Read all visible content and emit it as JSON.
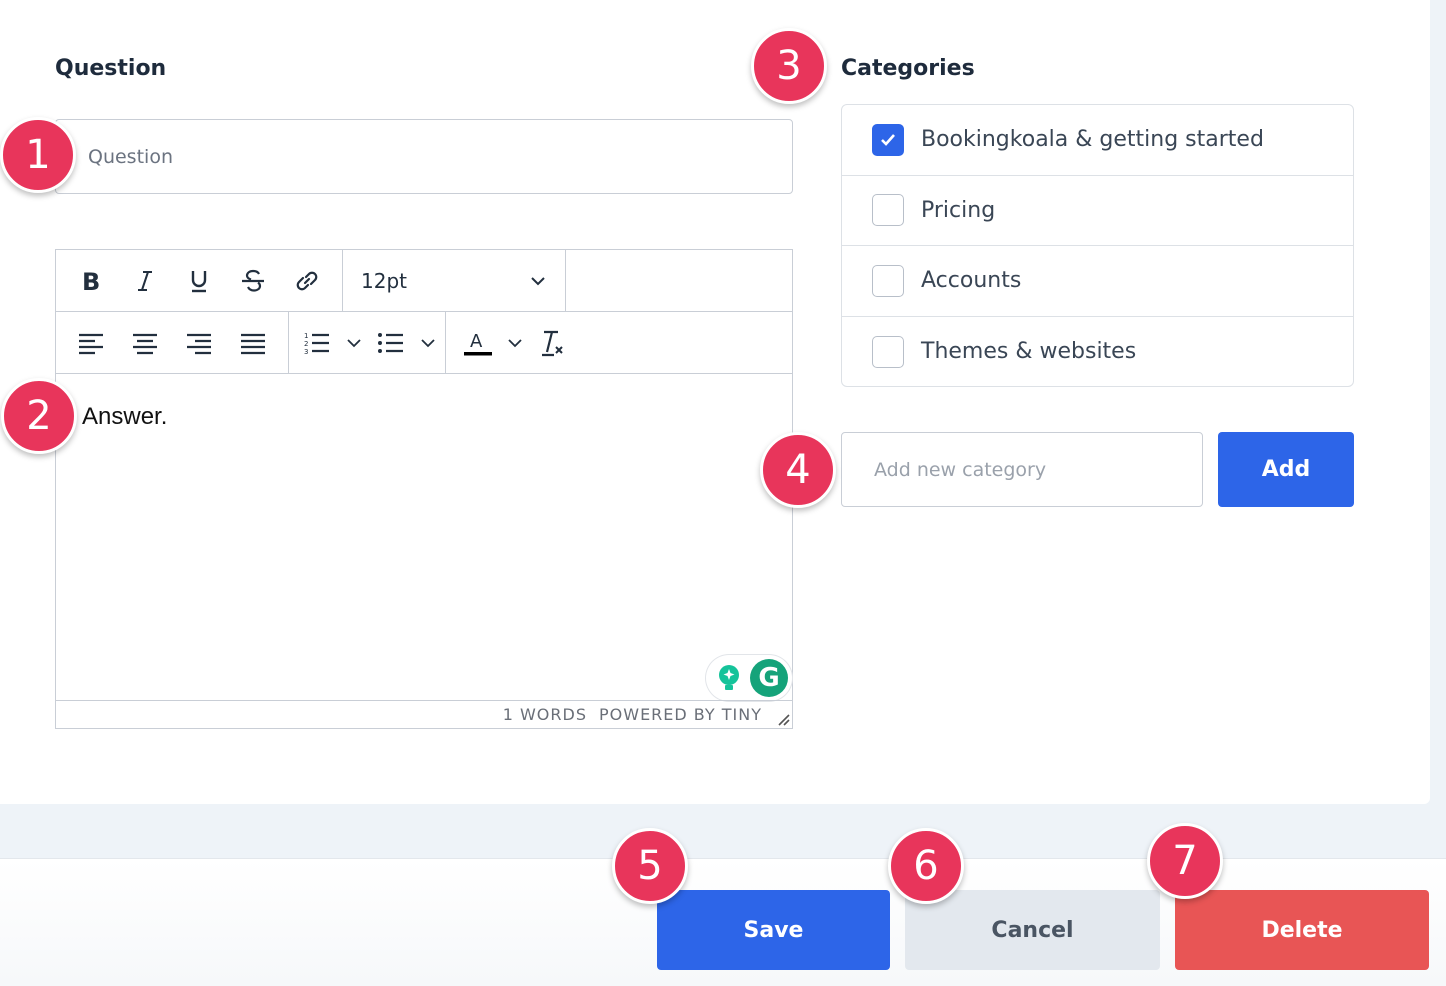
{
  "question": {
    "label": "Question",
    "placeholder": "Question"
  },
  "editor": {
    "font_size": "12pt",
    "content": "Answer.",
    "word_count": "1 WORDS",
    "powered_by": "POWERED BY TINY",
    "grammarly_letter": "G"
  },
  "categories": {
    "label": "Categories",
    "items": [
      {
        "label": "Bookingkoala & getting started",
        "checked": true
      },
      {
        "label": "Pricing",
        "checked": false
      },
      {
        "label": "Accounts",
        "checked": false
      },
      {
        "label": "Themes & websites",
        "checked": false
      }
    ],
    "new_placeholder": "Add new category",
    "add_label": "Add"
  },
  "footer": {
    "save_label": "Save",
    "cancel_label": "Cancel",
    "delete_label": "Delete"
  },
  "badges": [
    "1",
    "2",
    "3",
    "4",
    "5",
    "6",
    "7"
  ],
  "colors": {
    "primary": "#2d65e8",
    "danger": "#e85555",
    "badge": "#e8355b",
    "cancel_bg": "#e3e8ee"
  }
}
